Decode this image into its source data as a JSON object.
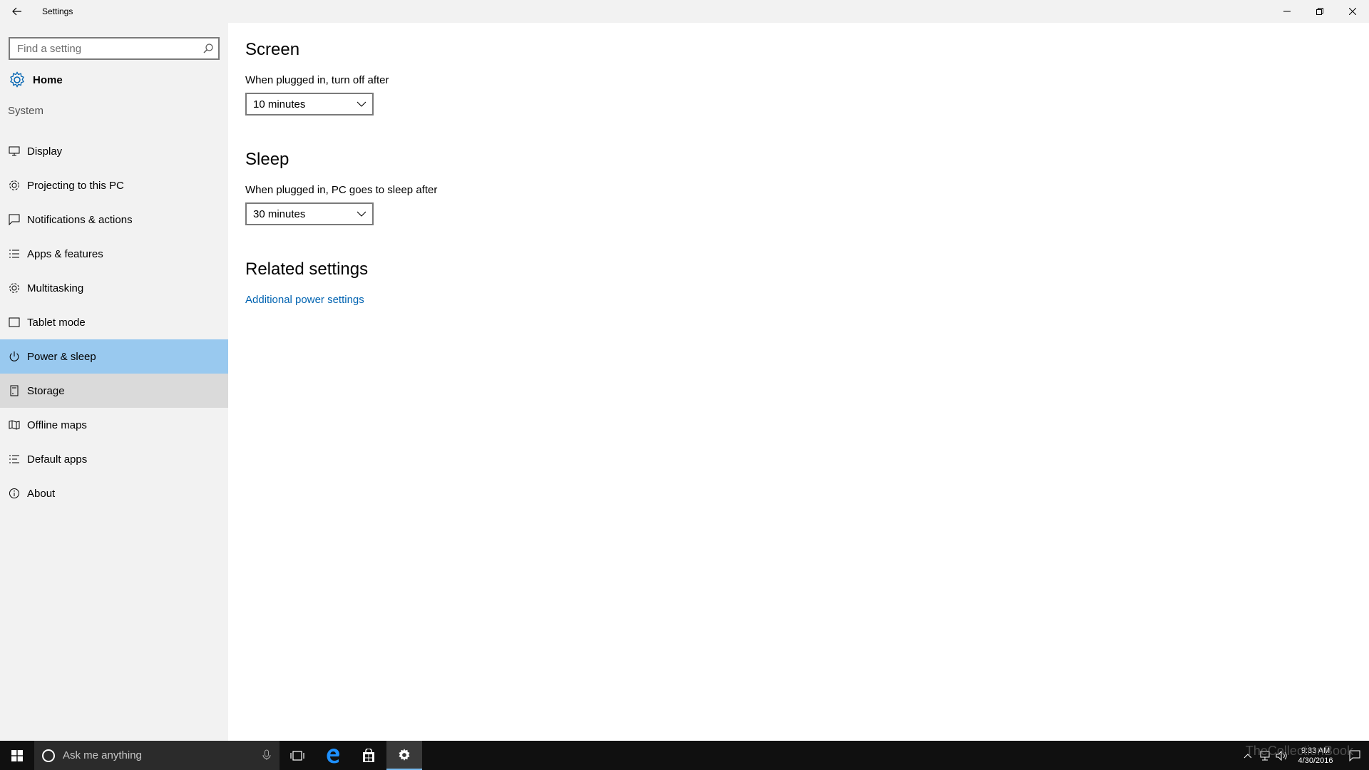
{
  "window": {
    "title": "Settings"
  },
  "sidebar": {
    "search_placeholder": "Find a setting",
    "home_label": "Home",
    "section_label": "System",
    "items": [
      {
        "label": "Display",
        "icon": "monitor-icon"
      },
      {
        "label": "Projecting to this PC",
        "icon": "projecting-icon"
      },
      {
        "label": "Notifications & actions",
        "icon": "notifications-icon"
      },
      {
        "label": "Apps & features",
        "icon": "list-icon"
      },
      {
        "label": "Multitasking",
        "icon": "multitasking-icon"
      },
      {
        "label": "Tablet mode",
        "icon": "tablet-icon"
      },
      {
        "label": "Power & sleep",
        "icon": "power-icon",
        "state": "selected"
      },
      {
        "label": "Storage",
        "icon": "storage-icon",
        "state": "hover"
      },
      {
        "label": "Offline maps",
        "icon": "map-icon"
      },
      {
        "label": "Default apps",
        "icon": "default-apps-icon"
      },
      {
        "label": "About",
        "icon": "info-icon"
      }
    ]
  },
  "content": {
    "screen": {
      "heading": "Screen",
      "label": "When plugged in, turn off after",
      "value": "10 minutes"
    },
    "sleep": {
      "heading": "Sleep",
      "label": "When plugged in, PC goes to sleep after",
      "value": "30 minutes"
    },
    "related": {
      "heading": "Related settings",
      "link": "Additional power settings"
    }
  },
  "taskbar": {
    "search_placeholder": "Ask me anything",
    "watermark": "TheCollectionBook",
    "time": "9:33 AM",
    "date": "4/30/2016"
  },
  "colors": {
    "accent": "#0063b1",
    "selected": "#99c9ef",
    "hover": "#dadada",
    "sidebar_bg": "#f2f2f2",
    "taskbar_bg": "#101010"
  }
}
